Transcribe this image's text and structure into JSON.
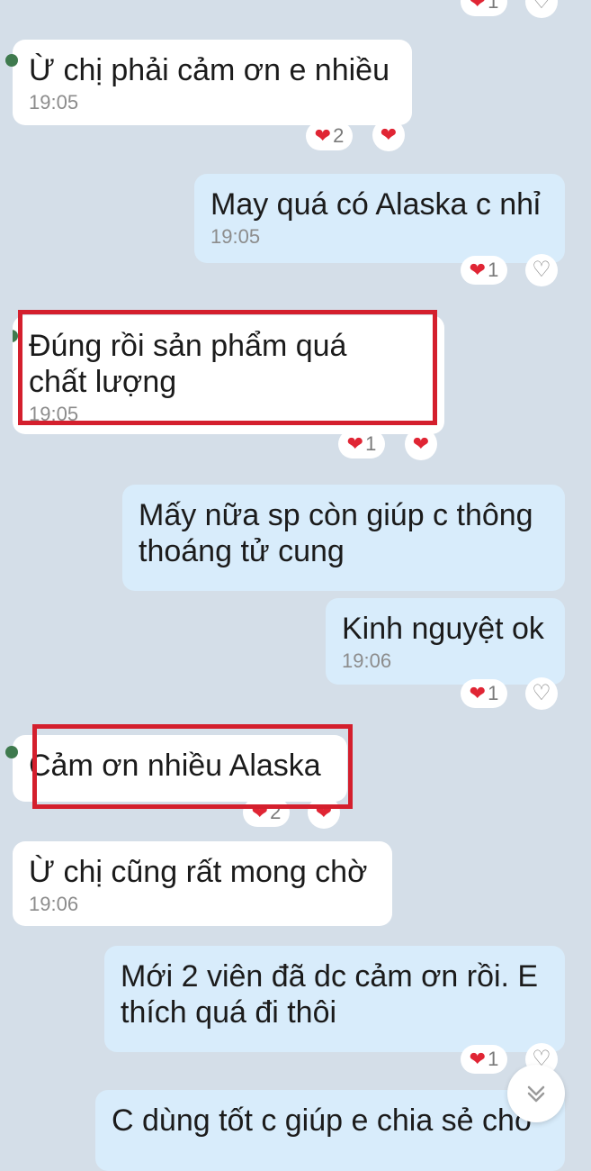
{
  "colors": {
    "background": "#d4dee8",
    "incoming_bubble": "#ffffff",
    "outgoing_bubble": "#d8ecfb",
    "reaction_heart": "#e02534",
    "highlight": "#d41f2d"
  },
  "messages": [
    {
      "id": "m1",
      "direction": "incoming",
      "text": "Ừ chị phải cảm ơn e nhiều",
      "time": "19:05",
      "reaction_count": "2"
    },
    {
      "id": "m2",
      "direction": "outgoing",
      "text": "May quá có Alaska c nhỉ",
      "time": "19:05",
      "reaction_count": "1"
    },
    {
      "id": "m3",
      "direction": "incoming",
      "text": "Đúng rồi sản phẩm quá chất lượng",
      "time": "19:05",
      "reaction_count": "1",
      "highlighted": true
    },
    {
      "id": "m4",
      "direction": "outgoing",
      "text": "Mấy nữa sp còn giúp c thông thoáng tử cung"
    },
    {
      "id": "m5",
      "direction": "outgoing",
      "text": "Kinh nguyệt ok",
      "time": "19:06",
      "reaction_count": "1"
    },
    {
      "id": "m6",
      "direction": "incoming",
      "text": "Cảm ơn nhiều Alaska",
      "reaction_count": "2",
      "highlighted": true
    },
    {
      "id": "m7",
      "direction": "incoming",
      "text": "Ừ chị cũng rất mong chờ",
      "time": "19:06"
    },
    {
      "id": "m8",
      "direction": "outgoing",
      "text": "Mới 2 viên đã dc cảm ơn rồi. E thích quá đi thôi",
      "reaction_count": "1"
    },
    {
      "id": "m9",
      "direction": "outgoing",
      "text": "C dùng tốt c giúp e chia sẻ cho"
    }
  ],
  "top_partial_reaction_count": "1",
  "icons": {
    "reaction": "heart-icon",
    "add_reaction": "heart-outline-icon",
    "scroll": "chevron-double-down-icon"
  }
}
